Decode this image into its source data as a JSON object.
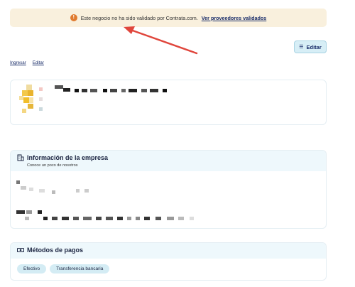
{
  "banner": {
    "icon": "warning-icon",
    "message": "Este negocio no ha sido validado por Contrata.com.",
    "link": "Ver proveedores validados",
    "background": "#f9f0dd"
  },
  "annotation": {
    "arrow_color": "#e0463c"
  },
  "toolbar": {
    "edit_label": "Editar",
    "edit_icon": "list-icon"
  },
  "links": {
    "login": "Ingresar",
    "edit": "Editar"
  },
  "info": {
    "title": "Información de la empresa",
    "subtitle": "Conoce un poco de nosotros",
    "icon": "building-icon"
  },
  "payments": {
    "title": "Métodos de pagos",
    "icon": "cash-icon",
    "methods": [
      "Efectivo",
      "Transferencia bancaria"
    ]
  }
}
